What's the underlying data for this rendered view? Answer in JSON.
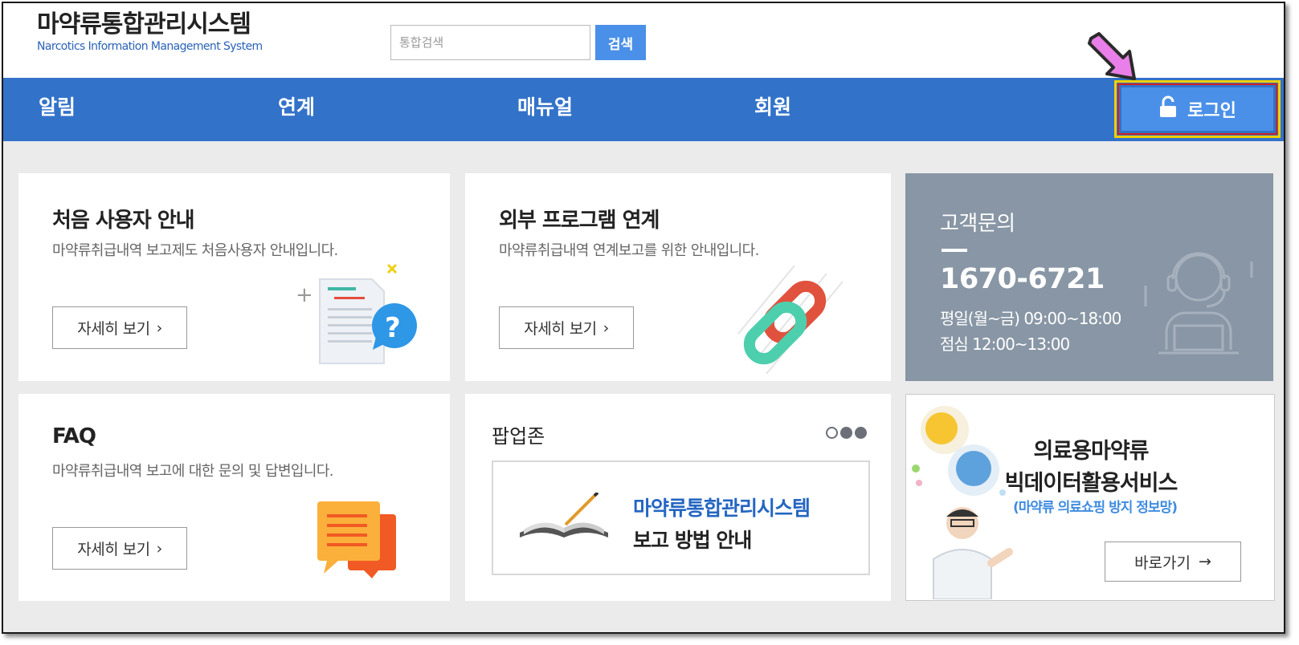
{
  "header": {
    "logo_title": "마약류통합관리시스템",
    "logo_subtitle": "Narcotics Information Management System",
    "search_placeholder": "통합검색",
    "search_button": "검색"
  },
  "nav": {
    "items": [
      {
        "label": "알림"
      },
      {
        "label": "연계"
      },
      {
        "label": "매뉴얼"
      },
      {
        "label": "회원"
      }
    ],
    "login_label": "로그인"
  },
  "cards": {
    "first_user": {
      "title": "처음 사용자 안내",
      "desc": "마약류취급내역 보고제도 처음사용자 안내입니다.",
      "button": "자세히 보기"
    },
    "external": {
      "title": "외부 프로그램 연계",
      "desc": "마약류취급내역 연계보고를 위한 안내입니다.",
      "button": "자세히 보기"
    },
    "faq": {
      "title": "FAQ",
      "desc": "마약류취급내역 보고에 대한 문의 및 답변입니다.",
      "button": "자세히 보기"
    }
  },
  "contact": {
    "title": "고객문의",
    "phone": "1670-6721",
    "hours_weekday": "평일(월~금) 09:00~18:00",
    "hours_lunch": "점심 12:00~13:00"
  },
  "popup": {
    "title": "팝업존",
    "line1": "마약류통합관리시스템",
    "line2": "보고 방법 안내"
  },
  "bigdata": {
    "line1": "의료용마약류",
    "line2": "빅데이터활용서비스",
    "line3": "(마약류 의료쇼핑 방지 정보망)",
    "button": "바로가기"
  },
  "colors": {
    "nav": "#3272c9",
    "button_blue": "#4a90e8",
    "contact_bg": "#8896a5",
    "link_blue": "#2466c2"
  }
}
